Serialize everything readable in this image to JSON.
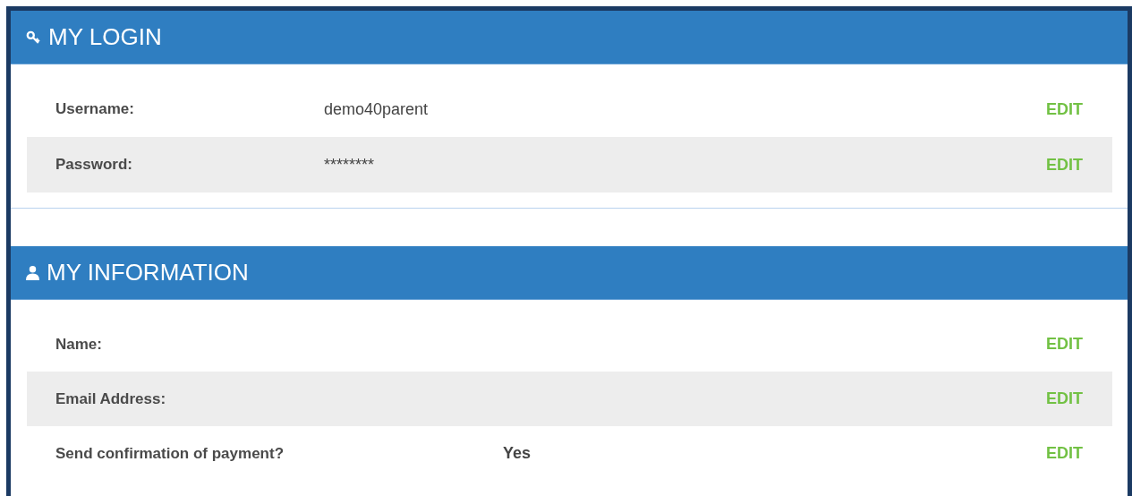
{
  "sections": [
    {
      "kind": "login",
      "title": "MY LOGIN",
      "rows": [
        {
          "label": "Username:",
          "value": "demo40parent",
          "action": "EDIT"
        },
        {
          "label": "Password:",
          "value": "********",
          "action": "EDIT"
        }
      ]
    },
    {
      "kind": "info",
      "title": "MY INFORMATION",
      "rows": [
        {
          "label": "Name:",
          "action": "EDIT"
        },
        {
          "label": "Email Address:",
          "action": "EDIT"
        },
        {
          "label": "Send confirmation of payment?",
          "value": "Yes",
          "action": "EDIT"
        }
      ]
    }
  ]
}
